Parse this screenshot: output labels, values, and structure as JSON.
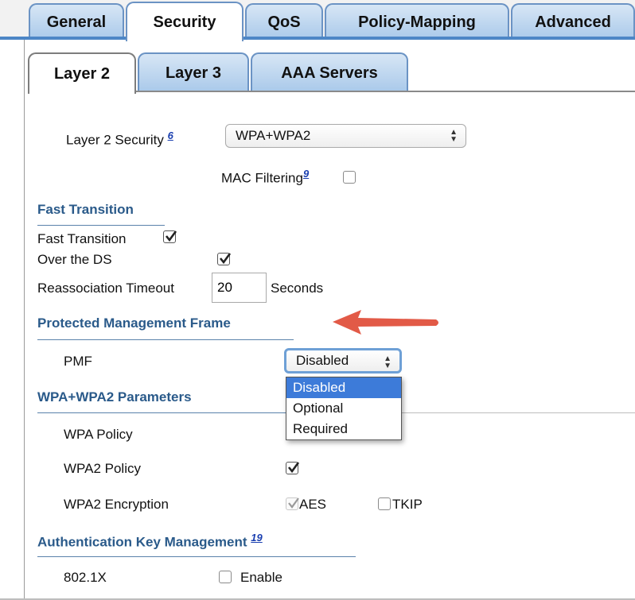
{
  "top_tabs": [
    "General",
    "Security",
    "QoS",
    "Policy-Mapping",
    "Advanced"
  ],
  "sub_tabs": [
    "Layer 2",
    "Layer 3",
    "AAA Servers"
  ],
  "layer2_security": {
    "label": "Layer 2 Security",
    "note": "6",
    "value": "WPA+WPA2"
  },
  "mac_filtering": {
    "label": "MAC Filtering",
    "note": "9",
    "checked": false
  },
  "fast_transition": {
    "heading": "Fast Transition",
    "ft_label": "Fast Transition",
    "ft_checked": true,
    "ds_label": "Over the DS",
    "ds_checked": true,
    "reassoc_label": "Reassociation Timeout",
    "reassoc_value": "20",
    "reassoc_unit": "Seconds"
  },
  "pmf": {
    "heading": "Protected Management Frame",
    "label": "PMF",
    "value": "Disabled",
    "options": [
      "Disabled",
      "Optional",
      "Required"
    ]
  },
  "wpa_params": {
    "heading": "WPA+WPA2 Parameters",
    "wpa_policy": "WPA Policy",
    "wpa2_policy": "WPA2 Policy",
    "wpa2_policy_checked": true,
    "wpa2_encryption": "WPA2 Encryption",
    "aes": "AES",
    "aes_checked": true,
    "tkip": "TKIP",
    "tkip_checked": false
  },
  "akm": {
    "heading": "Authentication Key Management",
    "note": "19",
    "dot1x": "802.1X",
    "enable": "Enable",
    "enable_checked": false
  },
  "colors": {
    "tab_gradient_top": "#d7e6f5",
    "tab_gradient_bottom": "#a9c9ea",
    "section": "#2a5a8a",
    "arrow": "#e25a47",
    "selected_option": "#3d7bd9"
  },
  "icons": {
    "arrow": "red-pointer-arrow-icon",
    "check": "checkmark-icon",
    "select_arrows": "up-down-chevron-icon"
  }
}
